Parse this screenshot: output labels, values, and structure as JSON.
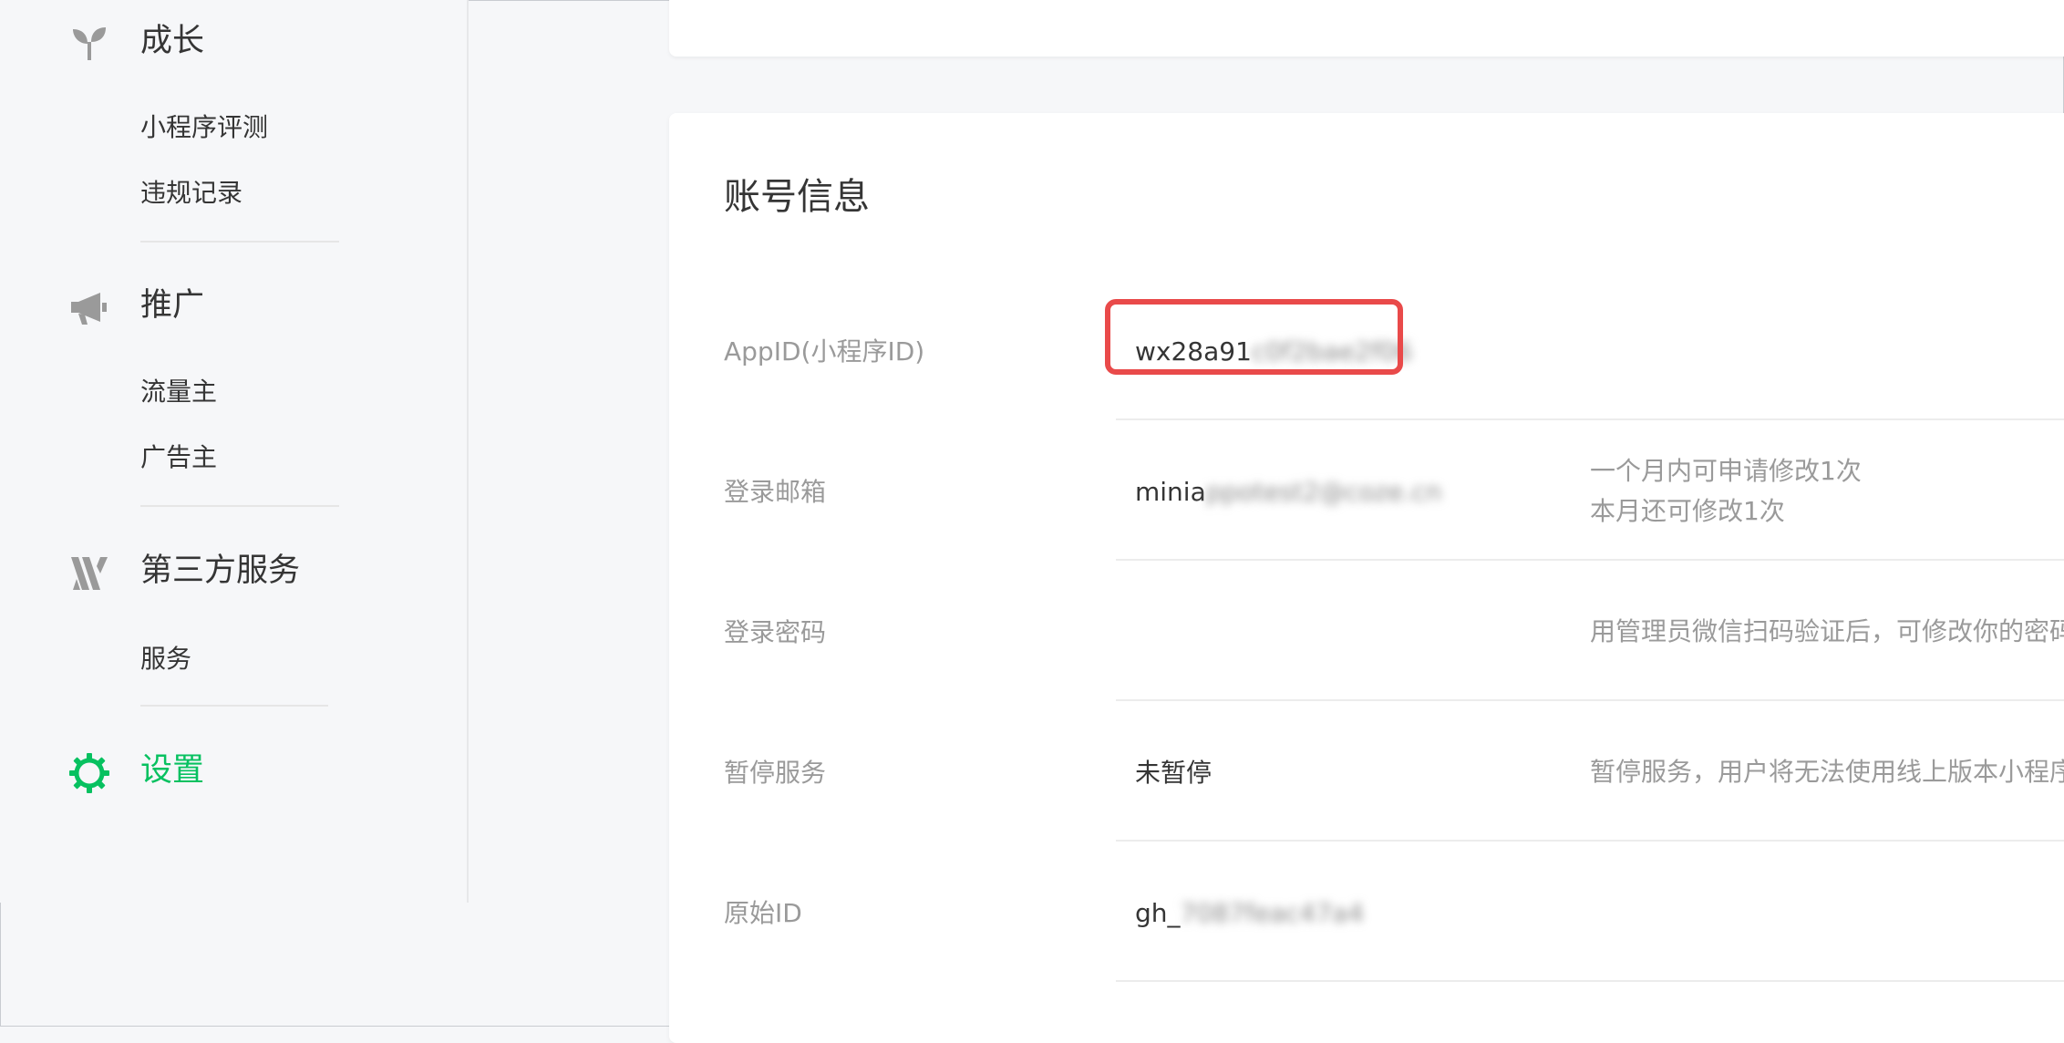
{
  "sidebar": {
    "groups": [
      {
        "title": "成长",
        "icon": "sprout-icon",
        "items": [
          "小程序评测",
          "违规记录"
        ]
      },
      {
        "title": "推广",
        "icon": "megaphone-icon",
        "items": [
          "流量主",
          "广告主"
        ]
      },
      {
        "title": "第三方服务",
        "icon": "third-party-icon",
        "items": [
          "服务"
        ]
      },
      {
        "title": "设置",
        "icon": "gear-icon",
        "items": [],
        "active": true
      }
    ]
  },
  "account": {
    "title": "账号信息",
    "rows": [
      {
        "label": "AppID(小程序ID)",
        "value": "wx28a91",
        "value_blurred": "c0f2bae2f06",
        "note": []
      },
      {
        "label": "登录邮箱",
        "value": "minia",
        "value_blurred": "ppotest2@coze.cn",
        "note": [
          "一个月内可申请修改1次",
          "本月还可修改1次"
        ]
      },
      {
        "label": "登录密码",
        "value": "",
        "value_blurred": "",
        "note": [
          "用管理员微信扫码验证后，可修改你的密码"
        ]
      },
      {
        "label": "暂停服务",
        "value": "未暂停",
        "value_blurred": "",
        "note": [
          "暂停服务，用户将无法使用线上版本小程序"
        ]
      },
      {
        "label": "原始ID",
        "value": "gh_",
        "value_blurred": "7087feac47a4",
        "note": []
      }
    ]
  },
  "colors": {
    "accent": "#07c160",
    "highlight": "#e94a4a"
  }
}
